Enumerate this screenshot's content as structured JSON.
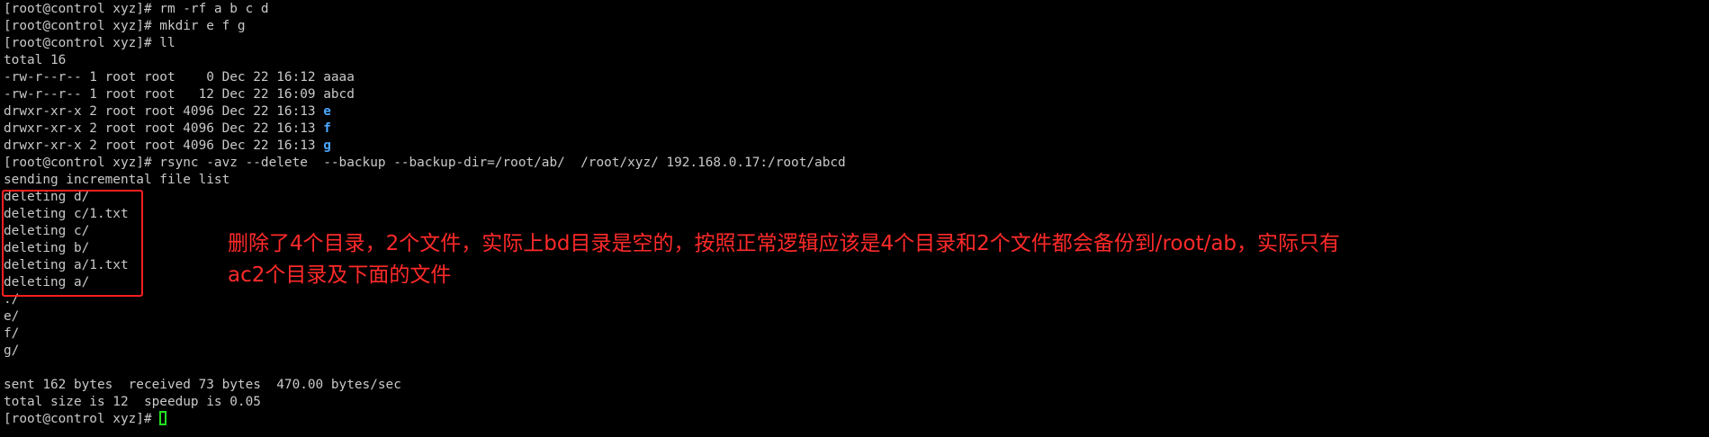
{
  "terminal": {
    "lines": [
      {
        "prefix": "[root@control xyz]# rm -rf a b c d"
      },
      {
        "prefix": "[root@control xyz]# mkdir e f g"
      },
      {
        "prefix": "[root@control xyz]# ll"
      },
      {
        "prefix": "total 16"
      },
      {
        "prefix": "-rw-r--r-- 1 root root    0 Dec 22 16:12 aaaa"
      },
      {
        "prefix": "-rw-r--r-- 1 root root   12 Dec 22 16:09 abcd"
      },
      {
        "prefix": "drwxr-xr-x 2 root root 4096 Dec 22 16:13 ",
        "dir": "e"
      },
      {
        "prefix": "drwxr-xr-x 2 root root 4096 Dec 22 16:13 ",
        "dir": "f"
      },
      {
        "prefix": "drwxr-xr-x 2 root root 4096 Dec 22 16:13 ",
        "dir": "g"
      },
      {
        "prefix": "[root@control xyz]# rsync -avz --delete  --backup --backup-dir=/root/ab/  /root/xyz/ 192.168.0.17:/root/abcd"
      },
      {
        "prefix": "sending incremental file list"
      },
      {
        "prefix": "deleting d/"
      },
      {
        "prefix": "deleting c/1.txt"
      },
      {
        "prefix": "deleting c/"
      },
      {
        "prefix": "deleting b/"
      },
      {
        "prefix": "deleting a/1.txt"
      },
      {
        "prefix": "deleting a/"
      },
      {
        "prefix": "./"
      },
      {
        "prefix": "e/"
      },
      {
        "prefix": "f/"
      },
      {
        "prefix": "g/"
      },
      {
        "prefix": ""
      },
      {
        "prefix": "sent 162 bytes  received 73 bytes  470.00 bytes/sec"
      },
      {
        "prefix": "total size is 12  speedup is 0.05"
      },
      {
        "prefix": "[root@control xyz]# ",
        "cursor": true
      }
    ]
  },
  "annotation": {
    "line1": "删除了4个目录，2个文件，实际上bd目录是空的，按照正常逻辑应该是4个目录和2个文件都会备份到/root/ab，实际只有",
    "line2": "ac2个目录及下面的文件"
  },
  "colors": {
    "background": "#000000",
    "text": "#c9c9c9",
    "directory": "#4aa6ff",
    "cursor": "#23e223",
    "annotation": "#ff2a2a",
    "highlight_border": "#ff2020"
  }
}
